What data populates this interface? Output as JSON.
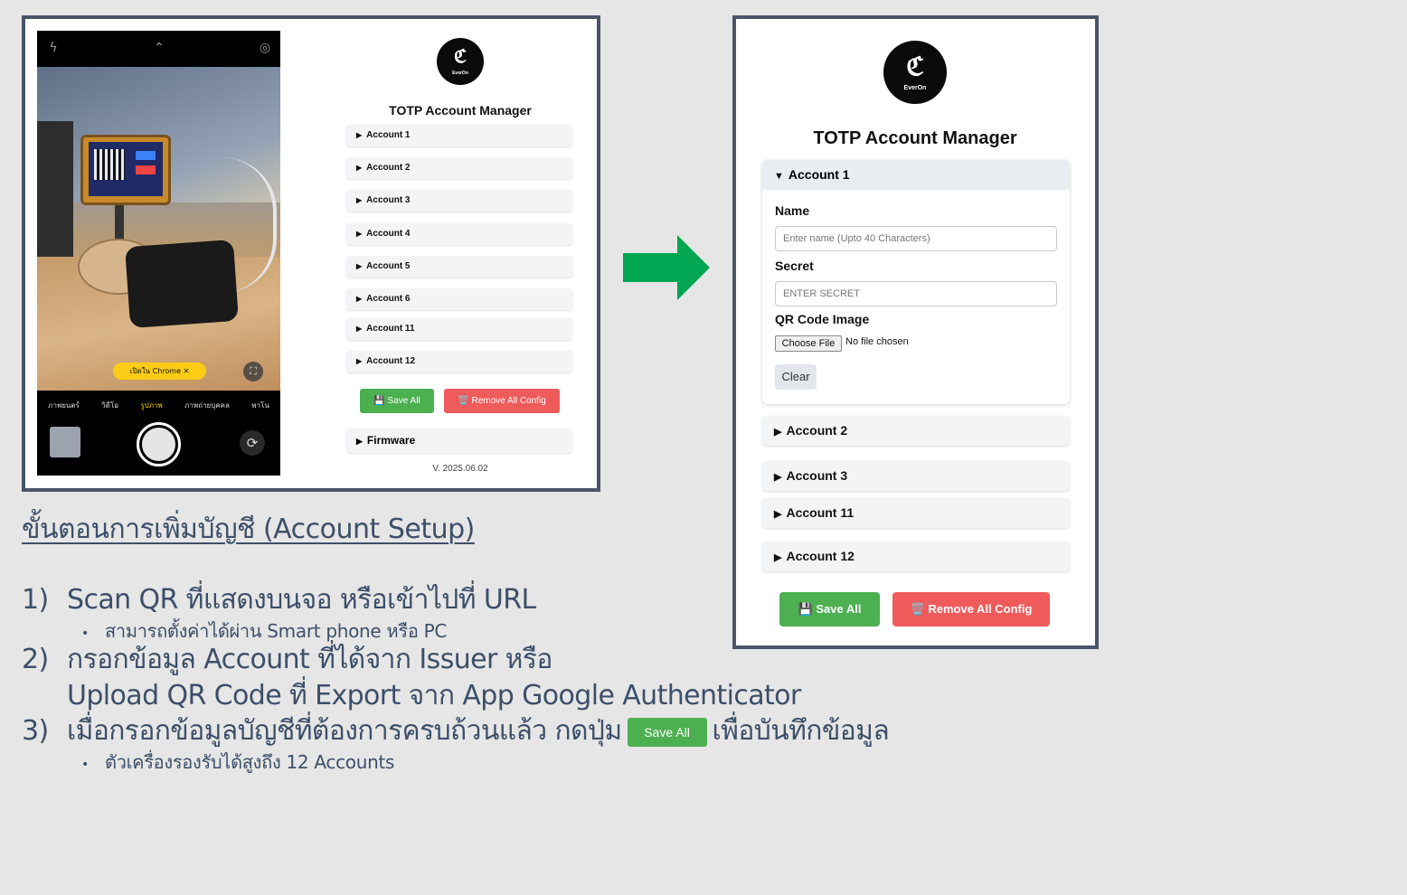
{
  "phone": {
    "chrome_pill": "เปิดใน Chrome",
    "modes": [
      "ภาพยนตร์",
      "วิดีโอ",
      "รูปภาพ",
      "ภาพถ่ายบุคคล",
      "พาโน"
    ]
  },
  "small_app": {
    "logo_word": "EverOn",
    "title": "TOTP Account Manager",
    "accounts": [
      "Account 1",
      "Account 2",
      "Account 3",
      "Account 4",
      "Account 5",
      "Account 6",
      "Account 11",
      "Account 12"
    ],
    "save_all": "💾 Save All",
    "remove_all": "🗑️ Remove All Config",
    "firmware": "Firmware",
    "version": "V. 2025.06.02"
  },
  "large_app": {
    "logo_word": "EverOn",
    "title": "TOTP Account Manager",
    "open_account": "Account 1",
    "name_label": "Name",
    "name_placeholder": "Enter name (Upto 40 Characters)",
    "secret_label": "Secret",
    "secret_placeholder": "ENTER SECRET",
    "qr_label": "QR Code Image",
    "choose_file": "Choose File",
    "no_file": "No file chosen",
    "clear": "Clear",
    "accounts": [
      "Account 2",
      "Account 3",
      "Account 11",
      "Account 12"
    ],
    "save_all": "💾 Save All",
    "remove_all": "🗑️ Remove All Config"
  },
  "instructions": {
    "heading": "ขั้นตอนการเพิ่มบัญชี (Account Setup)",
    "step1_num": "1)",
    "step1": "Scan QR ที่แสดงบนจอ หรือเข้าไปที่ URL",
    "step1_sub": "สามารถตั้งค่าได้ผ่าน Smart phone หรือ PC",
    "step2_num": "2)",
    "step2_a": "กรอกข้อมูล Account ที่ได้จาก Issuer หรือ",
    "step2_b": "Upload QR Code ที่ Export จาก App Google Authenticator",
    "step3_num": "3)",
    "step3_a": "เมื่อกรอกข้อมูลบัญชีที่ต้องการครบถ้วนแล้ว กดปุ่ม",
    "step3_btn": "Save All",
    "step3_b": "เพื่อบันทึกข้อมูล",
    "step3_sub": "ตัวเครื่องรองรับได้สูงถึง 12 Accounts"
  },
  "colors": {
    "green": "#4caf50",
    "red": "#ef5b5b",
    "text": "#3d4f69",
    "frame": "#4a5568",
    "arrow": "#00a651"
  }
}
